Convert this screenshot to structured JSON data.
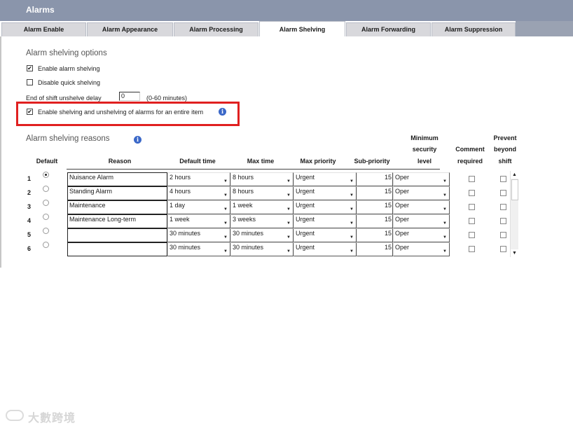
{
  "window": {
    "title": "Alarms"
  },
  "tabs": [
    {
      "label": "Alarm Enable",
      "active": false
    },
    {
      "label": "Alarm Appearance",
      "active": false
    },
    {
      "label": "Alarm Processing",
      "active": false
    },
    {
      "label": "Alarm Shelving",
      "active": true
    },
    {
      "label": "Alarm Forwarding",
      "active": false
    },
    {
      "label": "Alarm Suppression",
      "active": false
    }
  ],
  "options": {
    "title": "Alarm shelving options",
    "enable_shelving": {
      "label": "Enable alarm shelving",
      "checked": true
    },
    "disable_quick": {
      "label": "Disable quick shelving",
      "checked": false
    },
    "delay": {
      "label": "End of shift unshelve delay",
      "value": "0",
      "hint": "(0-60 minutes)"
    },
    "entire_item": {
      "label": "Enable shelving and unshelving of alarms for an entire item",
      "checked": true
    }
  },
  "reasons": {
    "title": "Alarm shelving reasons",
    "headers": {
      "default": "Default",
      "reason": "Reason",
      "default_time": "Default time",
      "max_time": "Max time",
      "max_priority": "Max priority",
      "sub_priority": "Sub-priority",
      "min_security_1": "Minimum",
      "min_security_2": "security",
      "min_security_3": "level",
      "comment_1": "Comment",
      "comment_2": "required",
      "prevent_1": "Prevent",
      "prevent_2": "beyond",
      "prevent_3": "shift"
    },
    "rows": [
      {
        "num": "1",
        "default": true,
        "reason": "Nuisance Alarm",
        "default_time": "2 hours",
        "max_time": "8 hours",
        "max_priority": "Urgent",
        "sub_priority": "15",
        "security": "Oper",
        "comment": false,
        "prevent": false
      },
      {
        "num": "2",
        "default": false,
        "reason": "Standing Alarm",
        "default_time": "4 hours",
        "max_time": "8 hours",
        "max_priority": "Urgent",
        "sub_priority": "15",
        "security": "Oper",
        "comment": false,
        "prevent": false
      },
      {
        "num": "3",
        "default": false,
        "reason": "Maintenance",
        "default_time": "1 day",
        "max_time": "1 week",
        "max_priority": "Urgent",
        "sub_priority": "15",
        "security": "Oper",
        "comment": false,
        "prevent": false
      },
      {
        "num": "4",
        "default": false,
        "reason": "Maintenance Long-term",
        "default_time": "1 week",
        "max_time": "3 weeks",
        "max_priority": "Urgent",
        "sub_priority": "15",
        "security": "Oper",
        "comment": false,
        "prevent": false
      },
      {
        "num": "5",
        "default": false,
        "reason": "",
        "default_time": "30 minutes",
        "max_time": "30 minutes",
        "max_priority": "Urgent",
        "sub_priority": "15",
        "security": "Oper",
        "comment": false,
        "prevent": false
      },
      {
        "num": "6",
        "default": false,
        "reason": "",
        "default_time": "30 minutes",
        "max_time": "30 minutes",
        "max_priority": "Urgent",
        "sub_priority": "15",
        "security": "Oper",
        "comment": false,
        "prevent": false
      }
    ]
  },
  "watermark": {
    "text": "大數跨境"
  },
  "colors": {
    "titlebar": "#8a95ab",
    "highlight": "#e02020",
    "info": "#3b68c8"
  }
}
